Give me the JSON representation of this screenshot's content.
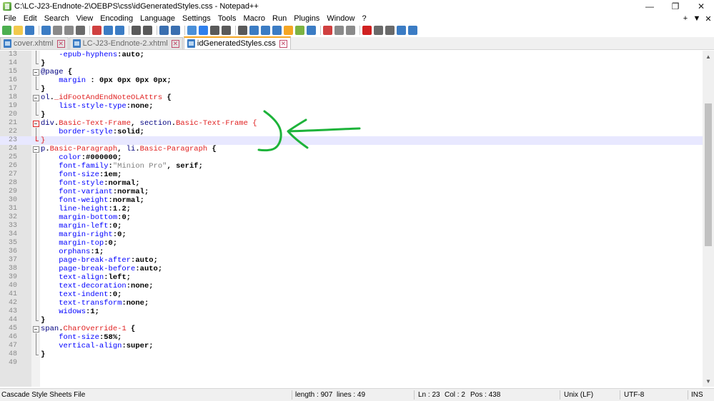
{
  "window": {
    "title": "C:\\LC-J23-Endnote-2\\OEBPS\\css\\idGeneratedStyles.css - Notepad++",
    "minimize": "—",
    "restore": "❐",
    "close": "✕"
  },
  "menu": {
    "items": [
      "File",
      "Edit",
      "Search",
      "View",
      "Encoding",
      "Language",
      "Settings",
      "Tools",
      "Macro",
      "Run",
      "Plugins",
      "Window",
      "?"
    ],
    "right": [
      "+",
      "▼",
      "✕"
    ]
  },
  "toolbar": {
    "icon_colors": [
      "#4caf50",
      "#f2c94c",
      "#3b7cc4",
      "#3b7cc4",
      "#8a8a8a",
      "#8a8a8a",
      "#6a6a6a",
      "#d04040",
      "#3b7cc4",
      "#3b7cc4",
      "#5a5a5a",
      "#5a5a5a",
      "#3a6fb0",
      "#3a6fb0",
      "#4a90d9",
      "#2f80ed",
      "#5a5a5a",
      "#5a5a5a",
      "#5a5a5a",
      "#3b7cc4",
      "#3b7cc4",
      "#3b7cc4",
      "#f5a623",
      "#7cb342",
      "#3b7cc4",
      "#d04040",
      "#8a8a8a",
      "#8a8a8a",
      "#d02020",
      "#6a6a6a",
      "#6a6a6a",
      "#3b7cc4",
      "#3b7cc4"
    ]
  },
  "tabs": [
    {
      "label": "cover.xhtml",
      "active": false
    },
    {
      "label": "LC-J23-Endnote-2.xhtml",
      "active": false
    },
    {
      "label": "idGeneratedStyles.css",
      "active": true
    }
  ],
  "code": {
    "current_line": 23,
    "lines": [
      {
        "n": "13",
        "fold": "mid",
        "parts": [
          [
            "    ",
            ""
          ],
          [
            "-epub-hyphens",
            "prop"
          ],
          [
            ":",
            "punc"
          ],
          [
            "auto",
            "val"
          ],
          [
            ";",
            "punc"
          ]
        ]
      },
      {
        "n": "14",
        "fold": "end",
        "parts": [
          [
            "}",
            "punc"
          ]
        ]
      },
      {
        "n": "15",
        "fold": "open",
        "parts": [
          [
            "@page",
            "sel"
          ],
          [
            " {",
            "punc"
          ]
        ]
      },
      {
        "n": "16",
        "fold": "mid",
        "parts": [
          [
            "    ",
            ""
          ],
          [
            "margin",
            "prop"
          ],
          [
            " : ",
            "punc"
          ],
          [
            "0px 0px 0px 0px",
            "val"
          ],
          [
            ";",
            "punc"
          ]
        ]
      },
      {
        "n": "17",
        "fold": "end",
        "parts": [
          [
            "}",
            "punc"
          ]
        ]
      },
      {
        "n": "18",
        "fold": "open",
        "parts": [
          [
            "ol",
            "sel"
          ],
          [
            ".",
            "punc"
          ],
          [
            "_idFootAndEndNoteOLAttrs",
            "cls"
          ],
          [
            " {",
            "punc"
          ]
        ]
      },
      {
        "n": "19",
        "fold": "mid",
        "parts": [
          [
            "    ",
            ""
          ],
          [
            "list-style-type",
            "prop"
          ],
          [
            ":",
            "punc"
          ],
          [
            "none",
            "val"
          ],
          [
            ";",
            "punc"
          ]
        ]
      },
      {
        "n": "20",
        "fold": "end",
        "parts": [
          [
            "}",
            "punc"
          ]
        ]
      },
      {
        "n": "21",
        "fold": "open-red",
        "parts": [
          [
            "div",
            "sel"
          ],
          [
            ".",
            "punc"
          ],
          [
            "Basic-Text-Frame",
            "cls"
          ],
          [
            ", ",
            "punc"
          ],
          [
            "section",
            "sel"
          ],
          [
            ".",
            "punc"
          ],
          [
            "Basic-Text-Frame",
            "cls"
          ],
          [
            " {",
            "brace-red"
          ]
        ]
      },
      {
        "n": "22",
        "fold": "mid",
        "parts": [
          [
            "    ",
            ""
          ],
          [
            "border-style",
            "prop"
          ],
          [
            ":",
            "punc"
          ],
          [
            "solid",
            "val"
          ],
          [
            ";",
            "punc"
          ]
        ]
      },
      {
        "n": "23",
        "fold": "end-red",
        "parts": [
          [
            "}",
            "brace-red"
          ]
        ]
      },
      {
        "n": "24",
        "fold": "open",
        "parts": [
          [
            "p",
            "sel"
          ],
          [
            ".",
            "punc"
          ],
          [
            "Basic-Paragraph",
            "cls"
          ],
          [
            ", ",
            "punc"
          ],
          [
            "li",
            "sel"
          ],
          [
            ".",
            "punc"
          ],
          [
            "Basic-Paragraph",
            "cls"
          ],
          [
            " {",
            "punc"
          ]
        ]
      },
      {
        "n": "25",
        "fold": "mid",
        "parts": [
          [
            "    ",
            ""
          ],
          [
            "color",
            "prop"
          ],
          [
            ":",
            "punc"
          ],
          [
            "#000000",
            "val"
          ],
          [
            ";",
            "punc"
          ]
        ]
      },
      {
        "n": "26",
        "fold": "mid",
        "parts": [
          [
            "    ",
            ""
          ],
          [
            "font-family",
            "prop"
          ],
          [
            ":",
            "punc"
          ],
          [
            "\"Minion Pro\"",
            "str"
          ],
          [
            ", ",
            "punc"
          ],
          [
            "serif",
            "val"
          ],
          [
            ";",
            "punc"
          ]
        ]
      },
      {
        "n": "27",
        "fold": "mid",
        "parts": [
          [
            "    ",
            ""
          ],
          [
            "font-size",
            "prop"
          ],
          [
            ":",
            "punc"
          ],
          [
            "1em",
            "val"
          ],
          [
            ";",
            "punc"
          ]
        ]
      },
      {
        "n": "28",
        "fold": "mid",
        "parts": [
          [
            "    ",
            ""
          ],
          [
            "font-style",
            "prop"
          ],
          [
            ":",
            "punc"
          ],
          [
            "normal",
            "val"
          ],
          [
            ";",
            "punc"
          ]
        ]
      },
      {
        "n": "29",
        "fold": "mid",
        "parts": [
          [
            "    ",
            ""
          ],
          [
            "font-variant",
            "prop"
          ],
          [
            ":",
            "punc"
          ],
          [
            "normal",
            "val"
          ],
          [
            ";",
            "punc"
          ]
        ]
      },
      {
        "n": "30",
        "fold": "mid",
        "parts": [
          [
            "    ",
            ""
          ],
          [
            "font-weight",
            "prop"
          ],
          [
            ":",
            "punc"
          ],
          [
            "normal",
            "val"
          ],
          [
            ";",
            "punc"
          ]
        ]
      },
      {
        "n": "31",
        "fold": "mid",
        "parts": [
          [
            "    ",
            ""
          ],
          [
            "line-height",
            "prop"
          ],
          [
            ":",
            "punc"
          ],
          [
            "1.2",
            "val"
          ],
          [
            ";",
            "punc"
          ]
        ]
      },
      {
        "n": "32",
        "fold": "mid",
        "parts": [
          [
            "    ",
            ""
          ],
          [
            "margin-bottom",
            "prop"
          ],
          [
            ":",
            "punc"
          ],
          [
            "0",
            "val"
          ],
          [
            ";",
            "punc"
          ]
        ]
      },
      {
        "n": "33",
        "fold": "mid",
        "parts": [
          [
            "    ",
            ""
          ],
          [
            "margin-left",
            "prop"
          ],
          [
            ":",
            "punc"
          ],
          [
            "0",
            "val"
          ],
          [
            ";",
            "punc"
          ]
        ]
      },
      {
        "n": "34",
        "fold": "mid",
        "parts": [
          [
            "    ",
            ""
          ],
          [
            "margin-right",
            "prop"
          ],
          [
            ":",
            "punc"
          ],
          [
            "0",
            "val"
          ],
          [
            ";",
            "punc"
          ]
        ]
      },
      {
        "n": "35",
        "fold": "mid",
        "parts": [
          [
            "    ",
            ""
          ],
          [
            "margin-top",
            "prop"
          ],
          [
            ":",
            "punc"
          ],
          [
            "0",
            "val"
          ],
          [
            ";",
            "punc"
          ]
        ]
      },
      {
        "n": "36",
        "fold": "mid",
        "parts": [
          [
            "    ",
            ""
          ],
          [
            "orphans",
            "prop"
          ],
          [
            ":",
            "punc"
          ],
          [
            "1",
            "val"
          ],
          [
            ";",
            "punc"
          ]
        ]
      },
      {
        "n": "37",
        "fold": "mid",
        "parts": [
          [
            "    ",
            ""
          ],
          [
            "page-break-after",
            "prop"
          ],
          [
            ":",
            "punc"
          ],
          [
            "auto",
            "val"
          ],
          [
            ";",
            "punc"
          ]
        ]
      },
      {
        "n": "38",
        "fold": "mid",
        "parts": [
          [
            "    ",
            ""
          ],
          [
            "page-break-before",
            "prop"
          ],
          [
            ":",
            "punc"
          ],
          [
            "auto",
            "val"
          ],
          [
            ";",
            "punc"
          ]
        ]
      },
      {
        "n": "39",
        "fold": "mid",
        "parts": [
          [
            "    ",
            ""
          ],
          [
            "text-align",
            "prop"
          ],
          [
            ":",
            "punc"
          ],
          [
            "left",
            "val"
          ],
          [
            ";",
            "punc"
          ]
        ]
      },
      {
        "n": "40",
        "fold": "mid",
        "parts": [
          [
            "    ",
            ""
          ],
          [
            "text-decoration",
            "prop"
          ],
          [
            ":",
            "punc"
          ],
          [
            "none",
            "val"
          ],
          [
            ";",
            "punc"
          ]
        ]
      },
      {
        "n": "41",
        "fold": "mid",
        "parts": [
          [
            "    ",
            ""
          ],
          [
            "text-indent",
            "prop"
          ],
          [
            ":",
            "punc"
          ],
          [
            "0",
            "val"
          ],
          [
            ";",
            "punc"
          ]
        ]
      },
      {
        "n": "42",
        "fold": "mid",
        "parts": [
          [
            "    ",
            ""
          ],
          [
            "text-transform",
            "prop"
          ],
          [
            ":",
            "punc"
          ],
          [
            "none",
            "val"
          ],
          [
            ";",
            "punc"
          ]
        ]
      },
      {
        "n": "43",
        "fold": "mid",
        "parts": [
          [
            "    ",
            ""
          ],
          [
            "widows",
            "prop"
          ],
          [
            ":",
            "punc"
          ],
          [
            "1",
            "val"
          ],
          [
            ";",
            "punc"
          ]
        ]
      },
      {
        "n": "44",
        "fold": "end",
        "parts": [
          [
            "}",
            "punc"
          ]
        ]
      },
      {
        "n": "45",
        "fold": "open",
        "parts": [
          [
            "span",
            "sel"
          ],
          [
            ".",
            "punc"
          ],
          [
            "CharOverride-1",
            "cls"
          ],
          [
            " {",
            "punc"
          ]
        ]
      },
      {
        "n": "46",
        "fold": "mid",
        "parts": [
          [
            "    ",
            ""
          ],
          [
            "font-size",
            "prop"
          ],
          [
            ":",
            "punc"
          ],
          [
            "58%",
            "val"
          ],
          [
            ";",
            "punc"
          ]
        ]
      },
      {
        "n": "47",
        "fold": "mid",
        "parts": [
          [
            "    ",
            ""
          ],
          [
            "vertical-align",
            "prop"
          ],
          [
            ":",
            "punc"
          ],
          [
            "super",
            "val"
          ],
          [
            ";",
            "punc"
          ]
        ]
      },
      {
        "n": "48",
        "fold": "end",
        "parts": [
          [
            "}",
            "punc"
          ]
        ]
      },
      {
        "n": "49",
        "fold": "",
        "parts": []
      }
    ]
  },
  "status": {
    "file_type": "Cascade Style Sheets File",
    "length": "length : 907",
    "lines": "lines : 49",
    "ln": "Ln : 23",
    "col": "Col : 2",
    "pos": "Pos : 438",
    "eol": "Unix (LF)",
    "encoding": "UTF-8",
    "mode": "INS"
  },
  "annotation_color": "#1db33a"
}
